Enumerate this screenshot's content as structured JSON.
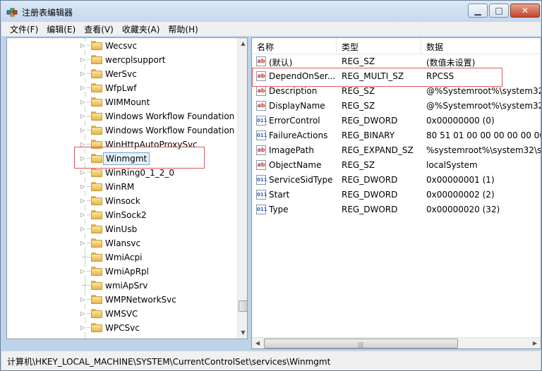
{
  "window": {
    "title": "注册表编辑器"
  },
  "menu": [
    "文件(F)",
    "编辑(E)",
    "查看(V)",
    "收藏夹(A)",
    "帮助(H)"
  ],
  "tree": [
    {
      "label": "Wecsvc",
      "expandable": true
    },
    {
      "label": "wercplsupport",
      "expandable": true
    },
    {
      "label": "WerSvc",
      "expandable": true
    },
    {
      "label": "WfpLwf",
      "expandable": true
    },
    {
      "label": "WIMMount",
      "expandable": true
    },
    {
      "label": "Windows Workflow Foundation",
      "expandable": true
    },
    {
      "label": "Windows Workflow Foundation",
      "expandable": true
    },
    {
      "label": "WinHttpAutoProxySvc",
      "expandable": true
    },
    {
      "label": "Winmgmt",
      "expandable": true,
      "selected": true
    },
    {
      "label": "WinRing0_1_2_0",
      "expandable": true
    },
    {
      "label": "WinRM",
      "expandable": true
    },
    {
      "label": "Winsock",
      "expandable": true
    },
    {
      "label": "WinSock2",
      "expandable": true
    },
    {
      "label": "WinUsb",
      "expandable": true
    },
    {
      "label": "Wlansvc",
      "expandable": true
    },
    {
      "label": "WmiAcpi",
      "expandable": false
    },
    {
      "label": "WmiApRpl",
      "expandable": true
    },
    {
      "label": "wmiApSrv",
      "expandable": false
    },
    {
      "label": "WMPNetworkSvc",
      "expandable": true
    },
    {
      "label": "WMSVC",
      "expandable": true
    },
    {
      "label": "WPCSvc",
      "expandable": true
    }
  ],
  "columns": {
    "name": "名称",
    "type": "类型",
    "data": "数据"
  },
  "values": [
    {
      "name": "(默认)",
      "type": "REG_SZ",
      "data": "(数值未设置)",
      "icon": "ab"
    },
    {
      "name": "DependOnSer...",
      "type": "REG_MULTI_SZ",
      "data": "RPCSS",
      "icon": "ab",
      "highlighted": true
    },
    {
      "name": "Description",
      "type": "REG_SZ",
      "data": "@%Systemroot%\\system32",
      "icon": "ab"
    },
    {
      "name": "DisplayName",
      "type": "REG_SZ",
      "data": "@%Systemroot%\\system32",
      "icon": "ab"
    },
    {
      "name": "ErrorControl",
      "type": "REG_DWORD",
      "data": "0x00000000 (0)",
      "icon": "bin"
    },
    {
      "name": "FailureActions",
      "type": "REG_BINARY",
      "data": "80 51 01 00 00 00 00 00 00",
      "icon": "bin"
    },
    {
      "name": "ImagePath",
      "type": "REG_EXPAND_SZ",
      "data": "%systemroot%\\system32\\s",
      "icon": "ab"
    },
    {
      "name": "ObjectName",
      "type": "REG_SZ",
      "data": "localSystem",
      "icon": "ab"
    },
    {
      "name": "ServiceSidType",
      "type": "REG_DWORD",
      "data": "0x00000001 (1)",
      "icon": "bin"
    },
    {
      "name": "Start",
      "type": "REG_DWORD",
      "data": "0x00000002 (2)",
      "icon": "bin"
    },
    {
      "name": "Type",
      "type": "REG_DWORD",
      "data": "0x00000020 (32)",
      "icon": "bin"
    }
  ],
  "status": "计算机\\HKEY_LOCAL_MACHINE\\SYSTEM\\CurrentControlSet\\services\\Winmgmt",
  "colors": {
    "highlight_box": "#e05a5a",
    "selection": "#e5f1fb"
  }
}
